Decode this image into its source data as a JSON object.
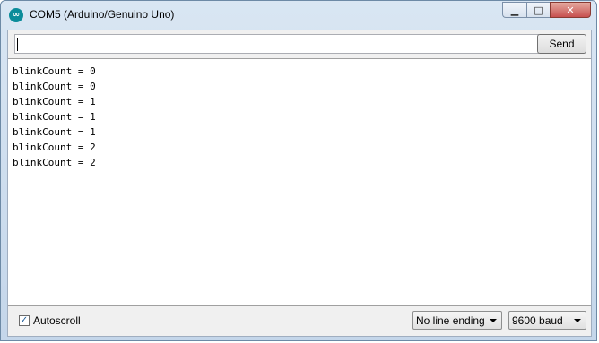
{
  "window": {
    "title": "COM5 (Arduino/Genuino Uno)",
    "icon": "arduino-logo-icon",
    "caption": {
      "minimize": "▁",
      "maximize": "□",
      "close": "✕"
    }
  },
  "input": {
    "value": "",
    "placeholder": ""
  },
  "send_button": {
    "label": "Send"
  },
  "output": {
    "lines": [
      "blinkCount = 0",
      "blinkCount = 0",
      "blinkCount = 1",
      "blinkCount = 1",
      "blinkCount = 1",
      "blinkCount = 2",
      "blinkCount = 2"
    ]
  },
  "footer": {
    "autoscroll": {
      "label": "Autoscroll",
      "checked": true,
      "check_glyph": "✓"
    },
    "line_ending": {
      "selected": "No line ending"
    },
    "baud_rate": {
      "selected": "9600 baud"
    }
  },
  "colors": {
    "titlebar": "#c4d6ea",
    "close_button": "#c75050",
    "arduino_teal": "#0b8c9a"
  }
}
